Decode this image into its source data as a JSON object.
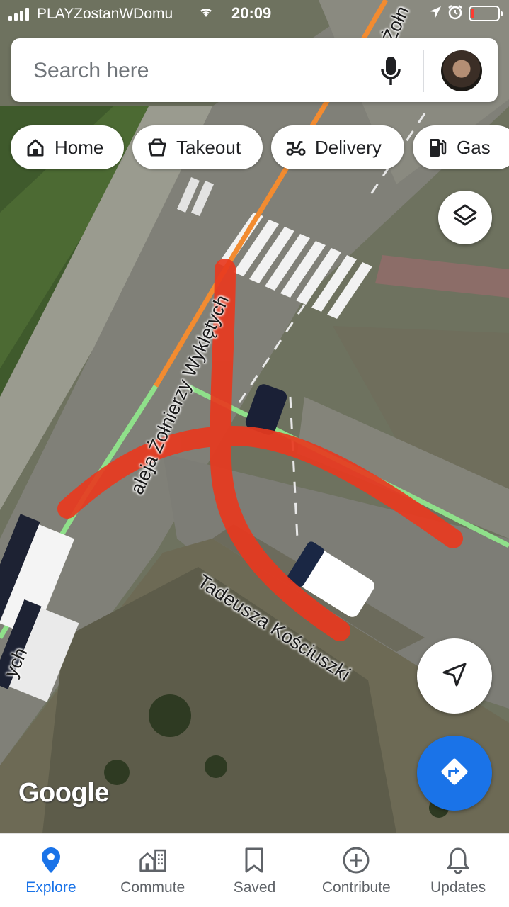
{
  "status_bar": {
    "carrier": "PLAYZostanWDomu",
    "time": "20:09"
  },
  "search": {
    "placeholder": "Search here",
    "mic_icon": "microphone-icon",
    "avatar": "user-avatar"
  },
  "chips": [
    {
      "label": "Home",
      "icon": "home-icon"
    },
    {
      "label": "Takeout",
      "icon": "takeout-icon"
    },
    {
      "label": "Delivery",
      "icon": "delivery-scooter-icon"
    },
    {
      "label": "Gas",
      "icon": "gas-station-icon"
    }
  ],
  "map": {
    "street_labels": [
      {
        "text": "aleja Żołnierzy Wyklętych"
      },
      {
        "text": "Tadeusza Kościuszki"
      },
      {
        "text": "ych"
      },
      {
        "text": "Żołn"
      }
    ],
    "logo": "Google",
    "colors": {
      "route_orange": "#f28b30",
      "route_green": "#8fe08a",
      "annotation_red": "#e8391f"
    }
  },
  "buttons": {
    "layers_icon": "layers-icon",
    "location_icon": "navigation-arrow-icon",
    "directions_icon": "directions-icon",
    "directions_color": "#1a73e8"
  },
  "bottom_nav": [
    {
      "label": "Explore",
      "icon": "location-pin-icon",
      "active": true
    },
    {
      "label": "Commute",
      "icon": "commute-buildings-icon",
      "active": false
    },
    {
      "label": "Saved",
      "icon": "bookmark-icon",
      "active": false
    },
    {
      "label": "Contribute",
      "icon": "add-circle-icon",
      "active": false
    },
    {
      "label": "Updates",
      "icon": "bell-icon",
      "active": false
    }
  ]
}
